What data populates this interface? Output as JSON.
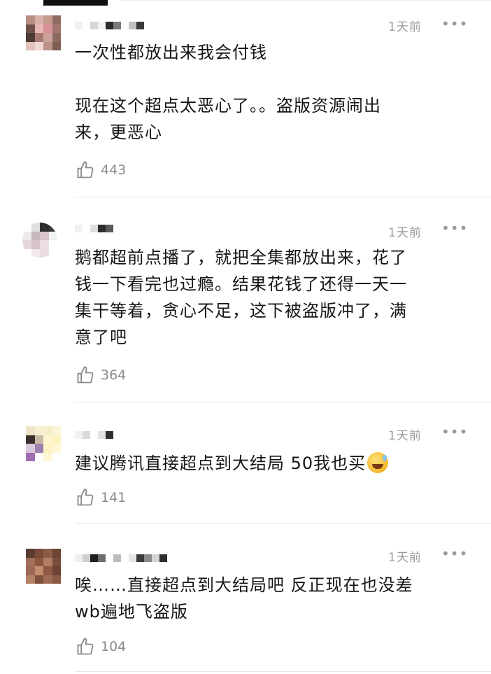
{
  "comments": [
    {
      "time": "1天前",
      "more": "•••",
      "paragraphs": [
        "一次性都放出来我会付钱",
        "",
        "现在这个超点太恶心了。。盗版资源闹出\n来，更恶心"
      ],
      "likes": "443",
      "avatar_colors": [
        "#b98f84",
        "#d8b0a7",
        "#c59a8c",
        "#8f6c62",
        "#6e5148",
        "#e7b8b5",
        "#d98f96",
        "#a2766c",
        "#4d3a35",
        "#a97a72",
        "#c9a39b",
        "#8c6a60",
        "#e1c3bb",
        "#f0d7d2",
        "#bb9188",
        "#7e5e56"
      ]
    },
    {
      "time": "1天前",
      "more": "•••",
      "paragraphs": [
        "鹅都超前点播了，就把全集都放出来，花了\n钱一下看完也过瘾。结果花钱了还得一天一\n集干等着，贪心不足，这下被盗版冲了，满\n意了吧"
      ],
      "likes": "364",
      "avatar_colors": [
        "#ffffff",
        "#dfdfdf",
        "#2e2e2e",
        "#3a3a3a",
        "#ece9ea",
        "#c7b6bd",
        "#d9c6cc",
        "#f2f2f2",
        "#e7d7dc",
        "#d7c4ca",
        "#ecdfe3",
        "#ffffff",
        "#ffffff",
        "#f3e8eb",
        "#e9dde1",
        "#ffffff"
      ]
    },
    {
      "time": "1天前",
      "more": "•••",
      "paragraphs": [
        "建议腾讯直接超点到大结局 50我也买"
      ],
      "emoji": "sweat-smile",
      "likes": "141",
      "avatar_colors": [
        "#ede3c9",
        "#f6f0d2",
        "#f4eec9",
        "#fbf6da",
        "#3a2f2c",
        "#c9b9a7",
        "#fff6cf",
        "#fdf3c0",
        "#d7c7da",
        "#9d7fb0",
        "#fff3c4",
        "#fff7d8",
        "#9f6db1",
        "#ffffff",
        "#fff6d6",
        "#ffffff"
      ]
    },
    {
      "time": "1天前",
      "more": "•••",
      "paragraphs": [
        "唉……直接超点到大结局吧 反正现在也没差\nwb遍地飞盗版"
      ],
      "likes": "104",
      "avatar_colors": [
        "#5a3b2f",
        "#7a4a3a",
        "#8d5c48",
        "#6d4636",
        "#a46f58",
        "#8a563f",
        "#b07c63",
        "#7b4c3a",
        "#9b6955",
        "#c28c70",
        "#8e5a45",
        "#6a4334",
        "#b48167",
        "#7f503d",
        "#a06b55",
        "#8c5945"
      ]
    }
  ]
}
